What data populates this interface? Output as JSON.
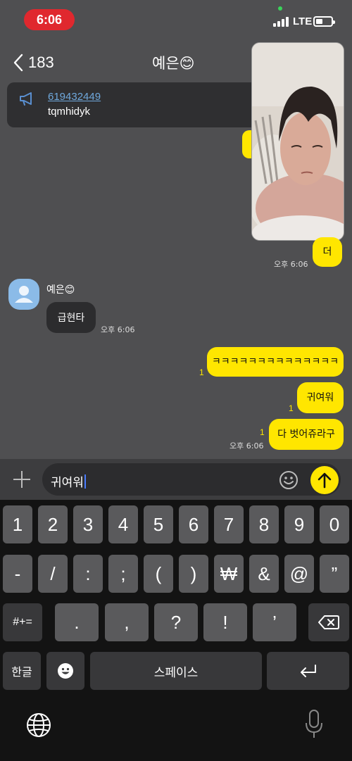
{
  "status_bar": {
    "time": "6:06",
    "network": "LTE"
  },
  "header": {
    "back_count": "183",
    "title": "예은😊"
  },
  "notice": {
    "link_text": "619432449",
    "subtext": "tqmhidyk"
  },
  "messages": {
    "sent_1": {
      "text": "더",
      "time": "오후 6:06"
    },
    "received_1": {
      "sender": "예은😊",
      "text": "급현타",
      "time": "오후 6:06"
    },
    "sent_2": {
      "text": "ㅋㅋㅋㅋㅋㅋㅋㅋㅋㅋㅋㅋㅋㅋ",
      "unread": "1"
    },
    "sent_3": {
      "text": "귀여워",
      "unread": "1"
    },
    "sent_4": {
      "text": "다 벗어쥬라구",
      "unread": "1",
      "time": "오후 6:06"
    }
  },
  "input": {
    "value": "귀여워"
  },
  "keyboard": {
    "row1": [
      "1",
      "2",
      "3",
      "4",
      "5",
      "6",
      "7",
      "8",
      "9",
      "0"
    ],
    "row2": [
      "-",
      "/",
      ":",
      ";",
      "(",
      ")",
      "₩",
      "&",
      "@",
      "”"
    ],
    "row3": {
      "switch": "#+=",
      "keys": [
        ".",
        ",",
        "?",
        "!",
        "’"
      ]
    },
    "row4": {
      "lang": "한글",
      "space": "스페이스"
    }
  },
  "colors": {
    "accent": "#ffe600",
    "background": "#4f4f51",
    "time_pill": "#e0282e",
    "link": "#6fa8dc"
  }
}
